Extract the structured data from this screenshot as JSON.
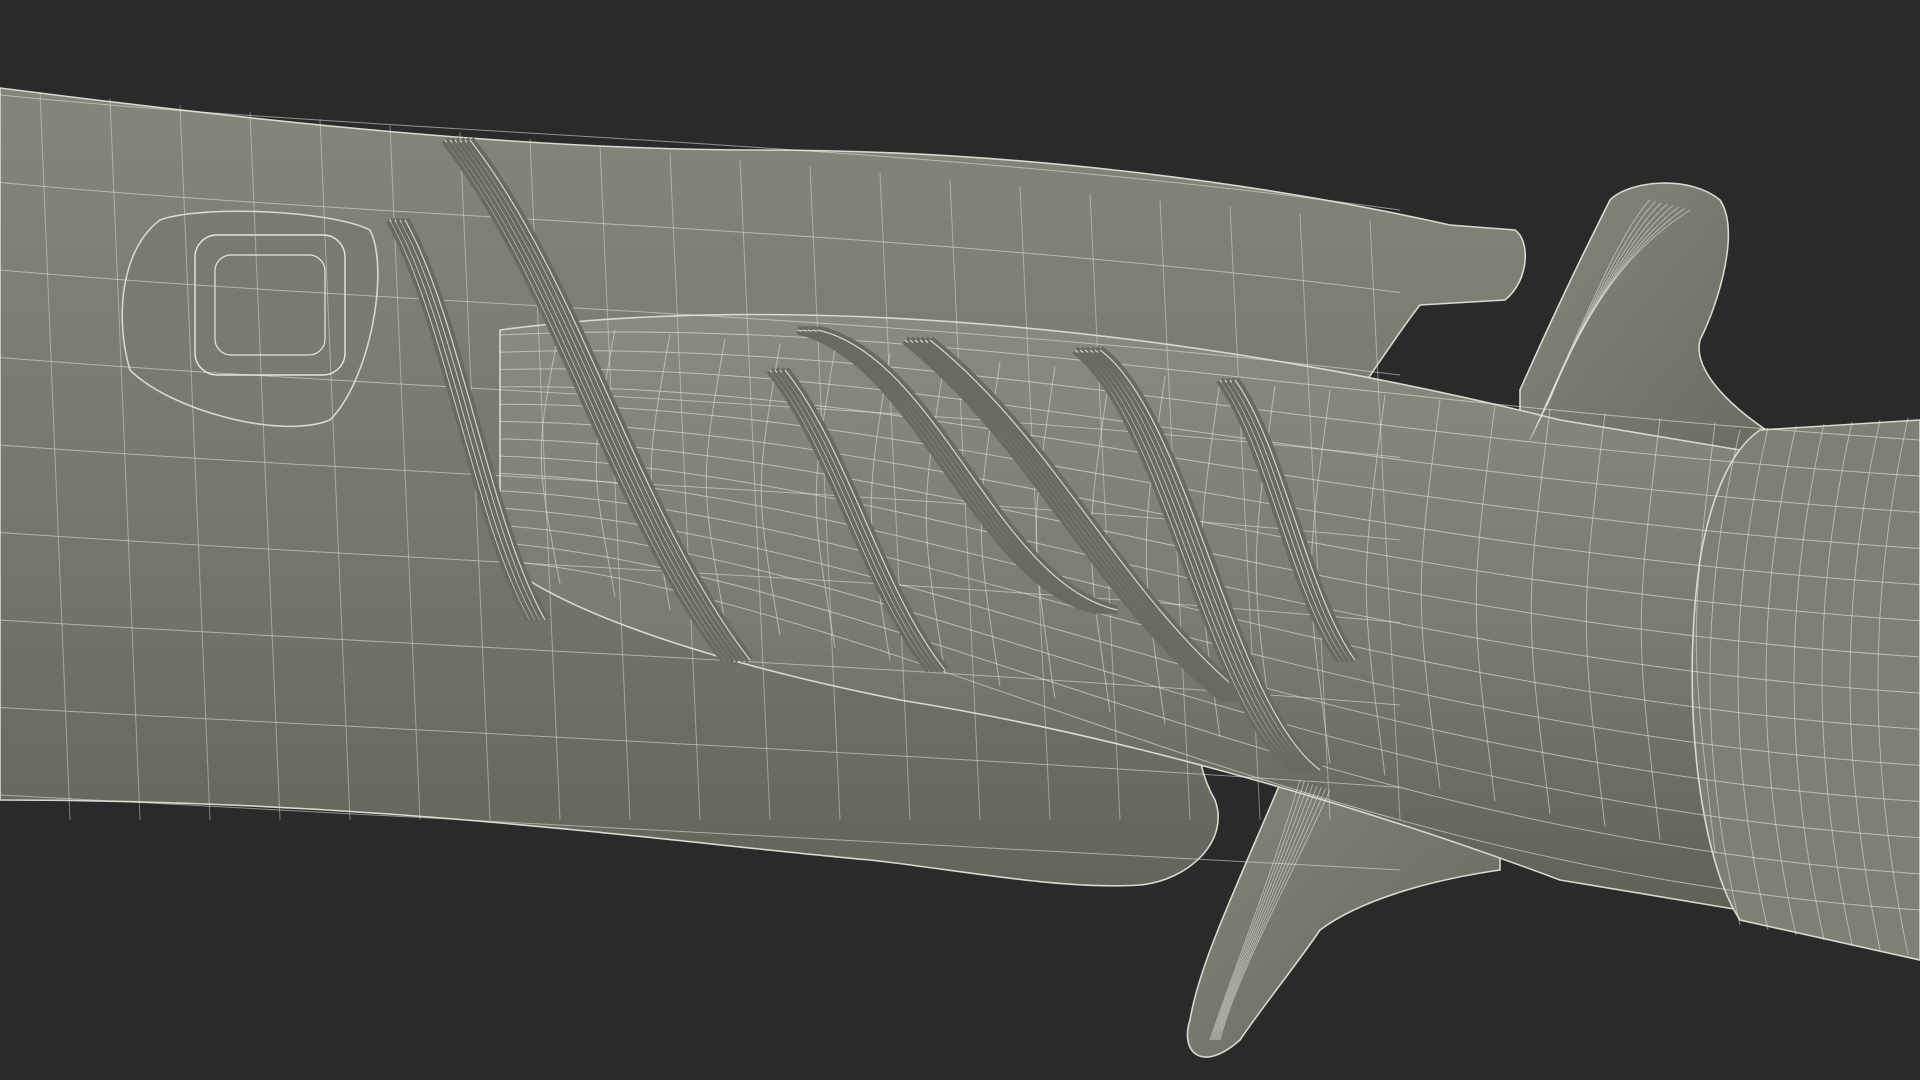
{
  "scene": {
    "subject": "3d-wireframe-render",
    "background_color": "#2a2a2a",
    "surface_color": "#7d7d72",
    "surface_shadow_color": "#5f5f57",
    "wire_color": "#e6e6de",
    "cord_color": "#6a6a62"
  }
}
